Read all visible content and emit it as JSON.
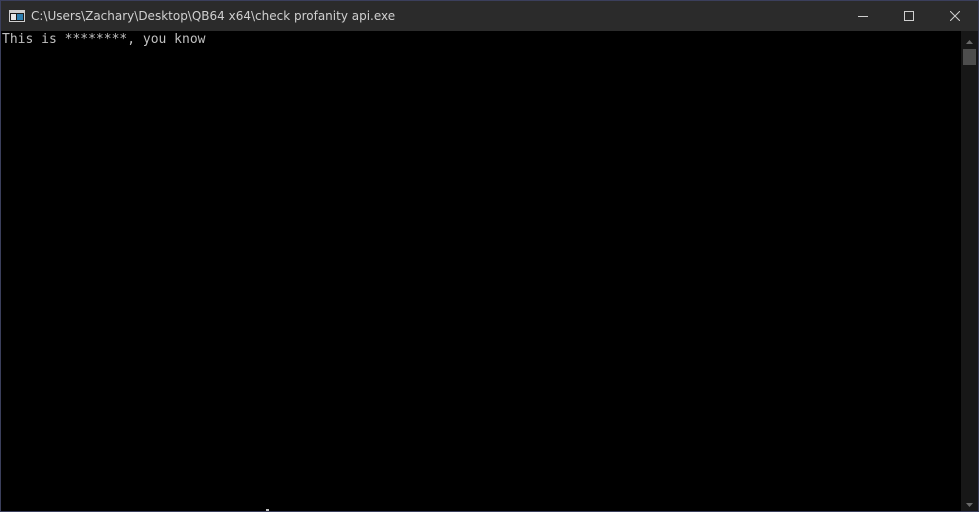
{
  "window": {
    "title": "C:\\Users\\Zachary\\Desktop\\QB64 x64\\check profanity api.exe",
    "app_icon": "console-app-icon",
    "caption_buttons": [
      "minimize-icon",
      "maximize-icon",
      "close-icon"
    ]
  },
  "console": {
    "output_line": "This is ********, you know",
    "background_color": "#000000",
    "text_color": "#c0c0c0"
  },
  "colors": {
    "titlebar": "#2b2b2b",
    "title_text": "#d0d0d0",
    "border": "#3b3f5c",
    "scrollbar_track": "#171717",
    "scrollbar_thumb": "#4d4d4d"
  }
}
